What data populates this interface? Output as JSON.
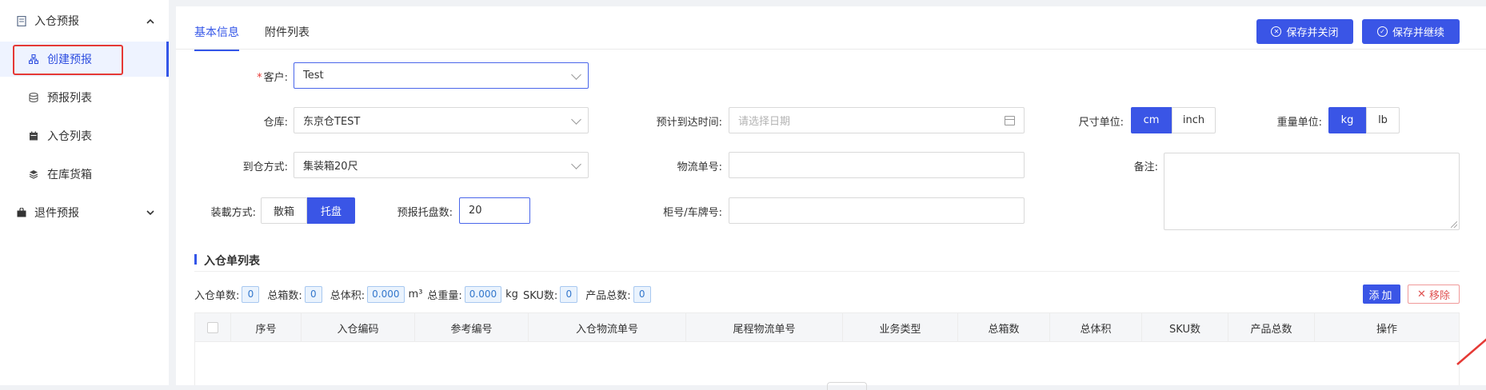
{
  "sidebar": {
    "group1": {
      "label": "入仓预报",
      "icon": "document-icon",
      "chevron": "^"
    },
    "items": [
      {
        "label": "创建预报",
        "icon": "sitemap-icon",
        "active": true
      },
      {
        "label": "预报列表",
        "icon": "database-icon",
        "active": false
      },
      {
        "label": "入仓列表",
        "icon": "calendar-icon",
        "active": false
      },
      {
        "label": "在库货箱",
        "icon": "layers-icon",
        "active": false
      }
    ],
    "group2": {
      "label": "退件预报",
      "icon": "bag-icon",
      "chevron": "⌄"
    }
  },
  "tabs": [
    {
      "label": "基本信息",
      "active": true
    },
    {
      "label": "附件列表",
      "active": false
    }
  ],
  "toolbar": {
    "save_close": "保存并关闭",
    "save_continue": "保存并继续"
  },
  "form": {
    "customer": {
      "label": "客户:",
      "required_mark": "*",
      "value": "Test"
    },
    "warehouse": {
      "label": "仓库:",
      "value": "东京仓TEST"
    },
    "arrival_time": {
      "label": "预计到达时间:",
      "placeholder": "请选择日期"
    },
    "size_unit": {
      "label": "尺寸单位:",
      "options": [
        "cm",
        "inch"
      ],
      "selected": "cm"
    },
    "weight_unit": {
      "label": "重量单位:",
      "options": [
        "kg",
        "lb"
      ],
      "selected": "kg"
    },
    "arrival_method": {
      "label": "到仓方式:",
      "value": "集装箱20尺"
    },
    "tracking_no": {
      "label": "物流单号:",
      "value": ""
    },
    "remark": {
      "label": "备注:",
      "value": ""
    },
    "loading_method": {
      "label": "装載方式:",
      "options": [
        "散箱",
        "托盘"
      ],
      "selected": "托盘"
    },
    "pallet_count": {
      "label": "预报托盘数:",
      "value": "20"
    },
    "container_no": {
      "label": "柜号/车牌号:",
      "value": ""
    }
  },
  "section": {
    "title": "入仓单列表"
  },
  "stats": {
    "inbound_count": {
      "label": "入仓单数:",
      "value": "0"
    },
    "box_count": {
      "label": "总箱数:",
      "value": "0"
    },
    "volume": {
      "label": "总体积:",
      "value": "0.000",
      "unit": "m³"
    },
    "weight": {
      "label": "总重量:",
      "value": "0.000",
      "unit": "kg"
    },
    "sku_count": {
      "label": "SKU数:",
      "value": "0"
    },
    "product_count": {
      "label": "产品总数:",
      "value": "0"
    }
  },
  "actions": {
    "add": "添加",
    "remove": "移除"
  },
  "table": {
    "columns": [
      "序号",
      "入仓编码",
      "参考编号",
      "入仓物流单号",
      "尾程物流单号",
      "业务类型",
      "总箱数",
      "总体积",
      "SKU数",
      "产品总数",
      "操作"
    ]
  },
  "colors": {
    "accent": "#3a55e6",
    "highlight_box": "#e53935",
    "annotation_arrow": "#e53935"
  }
}
